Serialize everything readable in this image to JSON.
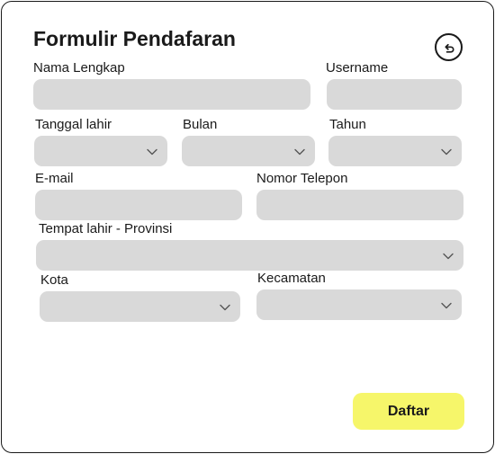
{
  "form": {
    "title": "Formulir Pendafaran",
    "reset_icon": "undo-icon",
    "chevron_icon": "chevron-down-icon",
    "fields": {
      "nama_lengkap": {
        "label": "Nama Lengkap",
        "value": ""
      },
      "username": {
        "label": "Username",
        "value": ""
      },
      "tanggal_lahir": {
        "label": "Tanggal lahir",
        "value": ""
      },
      "bulan": {
        "label": "Bulan",
        "value": ""
      },
      "tahun": {
        "label": "Tahun",
        "value": ""
      },
      "email": {
        "label": "E-mail",
        "value": ""
      },
      "nomor_telepon": {
        "label": "Nomor Telepon",
        "value": ""
      },
      "tempat_lahir": {
        "label": "Tempat lahir - Provinsi",
        "value": ""
      },
      "kota": {
        "label": "Kota",
        "value": ""
      },
      "kecamatan": {
        "label": "Kecamatan",
        "value": ""
      }
    },
    "submit_label": "Daftar"
  },
  "colors": {
    "field_bg": "#d9d9d9",
    "submit_bg": "#f6f66a",
    "text": "#1a1a1a",
    "border": "#1a1a1a"
  }
}
